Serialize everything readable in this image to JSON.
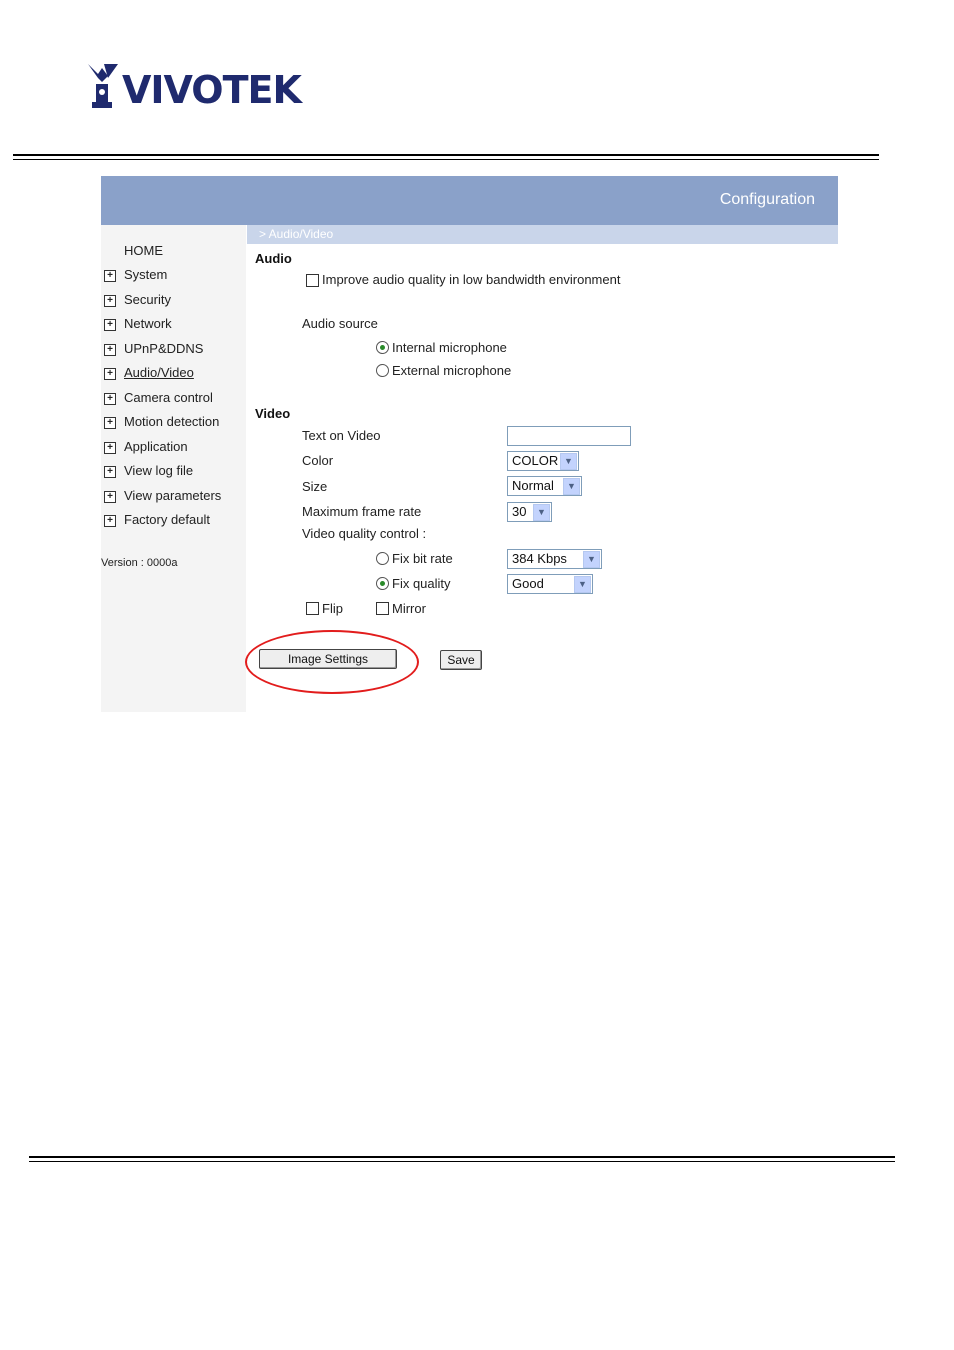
{
  "brand": {
    "logo_text": "VIVOTEK"
  },
  "header": {
    "title": "Configuration",
    "breadcrumb": "> Audio/Video"
  },
  "sidebar": {
    "home": "HOME",
    "items": [
      {
        "label": "System"
      },
      {
        "label": "Security"
      },
      {
        "label": "Network"
      },
      {
        "label": "UPnP&DDNS"
      },
      {
        "label": "Audio/Video",
        "active": true
      },
      {
        "label": "Camera control"
      },
      {
        "label": "Motion detection"
      },
      {
        "label": "Application"
      },
      {
        "label": "View log file"
      },
      {
        "label": "View parameters"
      },
      {
        "label": "Factory default"
      }
    ],
    "version": "Version : 0000a"
  },
  "audio": {
    "heading": "Audio",
    "improve_label": "Improve audio quality in low bandwidth environment",
    "improve_checked": false,
    "source_label": "Audio source",
    "internal_label": "Internal microphone",
    "external_label": "External microphone",
    "selected_source": "internal"
  },
  "video": {
    "heading": "Video",
    "text_on_video_label": "Text on Video",
    "text_on_video_value": "",
    "color_label": "Color",
    "color_value": "COLOR",
    "size_label": "Size",
    "size_value": "Normal",
    "fps_label": "Maximum frame rate",
    "fps_value": "30",
    "quality_control_label": "Video quality control :",
    "fix_bitrate_label": "Fix bit rate",
    "bitrate_value": "384 Kbps",
    "fix_quality_label": "Fix quality",
    "quality_value": "Good",
    "selected_mode": "fix_quality",
    "flip_label": "Flip",
    "mirror_label": "Mirror"
  },
  "buttons": {
    "image_settings": "Image Settings",
    "save": "Save"
  },
  "colors": {
    "banner": "#8aa1c9",
    "crumbbar": "#c9d5ea",
    "highlight_ellipse": "#e21c1c",
    "logo": "#1f2a6e"
  }
}
